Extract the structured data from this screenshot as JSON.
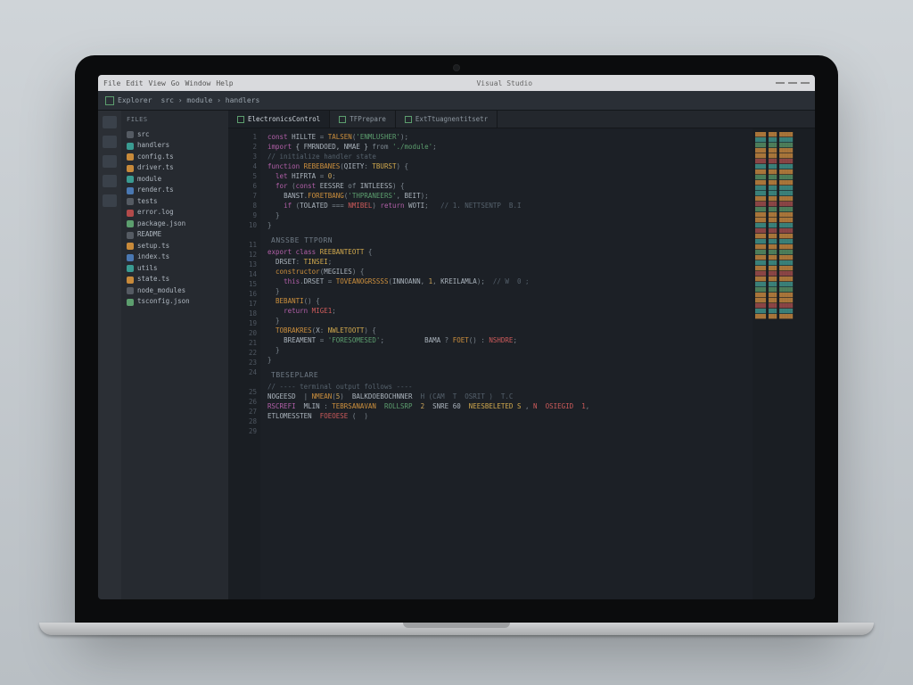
{
  "os_menu": [
    "File",
    "Edit",
    "View",
    "Go",
    "Window",
    "Help"
  ],
  "window_title": "Visual Studio",
  "app": {
    "explorer_label": "Explorer",
    "breadcrumb": "src › module › handlers",
    "tabs": [
      {
        "label": "ElectronicsControl",
        "active": true
      },
      {
        "label": "TFPrepare",
        "active": false
      },
      {
        "label": "ExtTtuagnentitsetr",
        "active": false
      }
    ]
  },
  "sidebar": {
    "header": "Files",
    "items": [
      {
        "c": "c-gry",
        "label": "src"
      },
      {
        "c": "c-teal",
        "label": "handlers"
      },
      {
        "c": "c-orn",
        "label": "config.ts"
      },
      {
        "c": "c-orn",
        "label": "driver.ts"
      },
      {
        "c": "c-teal",
        "label": "module"
      },
      {
        "c": "c-blu",
        "label": "render.ts"
      },
      {
        "c": "c-gry",
        "label": "tests"
      },
      {
        "c": "c-red",
        "label": "error.log"
      },
      {
        "c": "c-grn",
        "label": "package.json"
      },
      {
        "c": "c-gry",
        "label": "README"
      },
      {
        "c": "c-orn",
        "label": "setup.ts"
      },
      {
        "c": "c-blu",
        "label": "index.ts"
      },
      {
        "c": "c-teal",
        "label": "utils"
      },
      {
        "c": "c-orn",
        "label": "state.ts"
      },
      {
        "c": "c-gry",
        "label": "node_modules"
      },
      {
        "c": "c-grn",
        "label": "tsconfig.json"
      }
    ]
  },
  "section_header_1": "ANSSBE TTPORN",
  "section_header_2": "TBESEPLARE",
  "code": [
    [
      [
        "kw",
        "const "
      ],
      [
        "id",
        "HILLTE"
      ],
      [
        "pn",
        " = "
      ],
      [
        "fn",
        "TALSEN"
      ],
      [
        "pn",
        "("
      ],
      [
        "str",
        "'ENMLUSHER'"
      ],
      [
        "pn",
        ");"
      ]
    ],
    [
      [
        "kw",
        "import "
      ],
      [
        "id",
        "{ FMRNDOED, NMAE }"
      ],
      [
        "pn",
        " from "
      ],
      [
        "str",
        "'./module'"
      ],
      [
        "pn",
        ";"
      ]
    ],
    [
      [
        "cm",
        "// initialize handler state"
      ],
      [
        "pn",
        ""
      ]
    ],
    [
      [
        "kw",
        "function "
      ],
      [
        "fn",
        "REBEBANES"
      ],
      [
        "pn",
        "("
      ],
      [
        "id",
        "QIETY"
      ],
      [
        "pn",
        ": "
      ],
      [
        "ty",
        "TBURST"
      ],
      [
        "pn",
        ") {"
      ]
    ],
    [
      [
        "pn",
        "  "
      ],
      [
        "kw",
        "let "
      ],
      [
        "id",
        "HIFRTA"
      ],
      [
        "pn",
        " = "
      ],
      [
        "num",
        "0"
      ],
      [
        "pn",
        ";"
      ]
    ],
    [
      [
        "pn",
        "  "
      ],
      [
        "kw",
        "for "
      ],
      [
        "pn",
        "("
      ],
      [
        "kw",
        "const "
      ],
      [
        "id",
        "EESSRE"
      ],
      [
        "pn",
        " of "
      ],
      [
        "id",
        "INTLEESS"
      ],
      [
        "pn",
        ") {"
      ]
    ],
    [
      [
        "pn",
        "    "
      ],
      [
        "id",
        "BANST"
      ],
      [
        "pn",
        "."
      ],
      [
        "fn",
        "FORETBANG"
      ],
      [
        "pn",
        "("
      ],
      [
        "str",
        "'THPRANEERS'"
      ],
      [
        "pn",
        ", "
      ],
      [
        "id",
        "BEIT"
      ],
      [
        "pn",
        ");"
      ]
    ],
    [
      [
        "pn",
        "    "
      ],
      [
        "kw",
        "if "
      ],
      [
        "pn",
        "("
      ],
      [
        "id",
        "TOLATED"
      ],
      [
        "pn",
        " === "
      ],
      [
        "err",
        "NMIBEL"
      ],
      [
        "pn",
        ") "
      ],
      [
        "kw",
        "return "
      ],
      [
        "id",
        "WOTI"
      ],
      [
        "pn",
        ";   "
      ],
      [
        "cm",
        "// 1. NETTSENTP  B.I"
      ]
    ],
    [
      [
        "pn",
        "  }"
      ]
    ],
    [
      [
        "pn",
        "}"
      ]
    ],
    [
      [
        "pn",
        ""
      ]
    ],
    [
      [
        "kw",
        "export "
      ],
      [
        "kw",
        "class "
      ],
      [
        "ty",
        "REEBANTEOTT"
      ],
      [
        "pn",
        " {"
      ]
    ],
    [
      [
        "pn",
        "  "
      ],
      [
        "id",
        "DRSET"
      ],
      [
        "pn",
        ": "
      ],
      [
        "ty",
        "TINSEI"
      ],
      [
        "pn",
        ";"
      ]
    ],
    [
      [
        "pn",
        "  "
      ],
      [
        "fn",
        "constructor"
      ],
      [
        "pn",
        "("
      ],
      [
        "id",
        "MEGILES"
      ],
      [
        "pn",
        ") {"
      ]
    ],
    [
      [
        "pn",
        "    "
      ],
      [
        "kw",
        "this"
      ],
      [
        "pn",
        "."
      ],
      [
        "id",
        "DRSET"
      ],
      [
        "pn",
        " = "
      ],
      [
        "fn",
        "TOVEANOGRSSSS"
      ],
      [
        "pn",
        "("
      ],
      [
        "id",
        "INNOANN"
      ],
      [
        "pn",
        ", "
      ],
      [
        "num",
        "1"
      ],
      [
        "pn",
        ", "
      ],
      [
        "id",
        "KREILAMLA"
      ],
      [
        "pn",
        ");  "
      ],
      [
        "cm",
        "// W  0 ;"
      ]
    ],
    [
      [
        "pn",
        "  }"
      ]
    ],
    [
      [
        "pn",
        "  "
      ],
      [
        "fn",
        "BEBANTI"
      ],
      [
        "pn",
        "() {"
      ]
    ],
    [
      [
        "pn",
        "    "
      ],
      [
        "kw",
        "return "
      ],
      [
        "err",
        "MIGE1"
      ],
      [
        "pn",
        ";"
      ]
    ],
    [
      [
        "pn",
        "  }"
      ]
    ],
    [
      [
        "pn",
        "  "
      ],
      [
        "fn",
        "TOBRAKRES"
      ],
      [
        "pn",
        "("
      ],
      [
        "id",
        "X"
      ],
      [
        "pn",
        ": "
      ],
      [
        "ty",
        "NWLETOOTT"
      ],
      [
        "pn",
        ") {"
      ]
    ],
    [
      [
        "pn",
        "    "
      ],
      [
        "id",
        "BREAMENT"
      ],
      [
        "pn",
        " = "
      ],
      [
        "str",
        "'FORESOMESED'"
      ],
      [
        "pn",
        ";          "
      ],
      [
        "id",
        "BAMA"
      ],
      [
        "pn",
        " ? "
      ],
      [
        "fn",
        "FOET"
      ],
      [
        "pn",
        "() : "
      ],
      [
        "err",
        "NSHDRE"
      ],
      [
        "pn",
        ";"
      ]
    ],
    [
      [
        "pn",
        "  }"
      ]
    ],
    [
      [
        "pn",
        "}"
      ]
    ],
    [
      [
        "pn",
        ""
      ]
    ],
    [
      [
        "cm",
        "// ---- terminal output follows ----"
      ]
    ],
    [
      [
        "id",
        "NOGEESD  "
      ],
      [
        "pn",
        "| "
      ],
      [
        "fn",
        "NMEAN"
      ],
      [
        "pn",
        "("
      ],
      [
        "num",
        "5"
      ],
      [
        "pn",
        ")"
      ],
      [
        "pn",
        "  "
      ],
      [
        "id",
        "BALKDOEBOCHNNER"
      ],
      [
        "pn",
        "  "
      ],
      [
        "cm",
        "H (CAM  T  OSRIT )  T.C"
      ]
    ],
    [
      [
        "kw",
        "RSCREFI"
      ],
      [
        "pn",
        "  "
      ],
      [
        "id",
        "MLIN"
      ],
      [
        "pn",
        " : "
      ],
      [
        "fn",
        "TEBRSANAVAN"
      ],
      [
        "pn",
        "  "
      ],
      [
        "str",
        "ROLLSRP"
      ],
      [
        "pn",
        "  "
      ],
      [
        "num",
        "2"
      ],
      [
        "pn",
        "  "
      ],
      [
        "id",
        "SNRE 60"
      ],
      [
        "pn",
        "  "
      ],
      [
        "ty",
        "NEESBELETED S"
      ],
      [
        "pn",
        " , "
      ],
      [
        "err",
        "N  OSIEGID  1"
      ],
      [
        "pn",
        ","
      ]
    ],
    [
      [
        "pn",
        ""
      ]
    ],
    [
      [
        "id",
        "ETLOMESSTEN"
      ],
      [
        "pn",
        "  "
      ],
      [
        "err",
        "FOEOESE"
      ],
      [
        "pn",
        " (  )"
      ]
    ]
  ],
  "minimap_rows": [
    "mm-o",
    "mm-t",
    "mm-g",
    "mm-o",
    "mm-o",
    "mm-r",
    "mm-t",
    "mm-o",
    "mm-g",
    "mm-o",
    "mm-t",
    "mm-t",
    "mm-o",
    "mm-r",
    "mm-g",
    "mm-o",
    "mm-o",
    "mm-t",
    "mm-r",
    "mm-o",
    "mm-t",
    "mm-o",
    "mm-g",
    "mm-o",
    "mm-t",
    "mm-o",
    "mm-r",
    "mm-o",
    "mm-t",
    "mm-g",
    "mm-o",
    "mm-o",
    "mm-r",
    "mm-t",
    "mm-o"
  ]
}
